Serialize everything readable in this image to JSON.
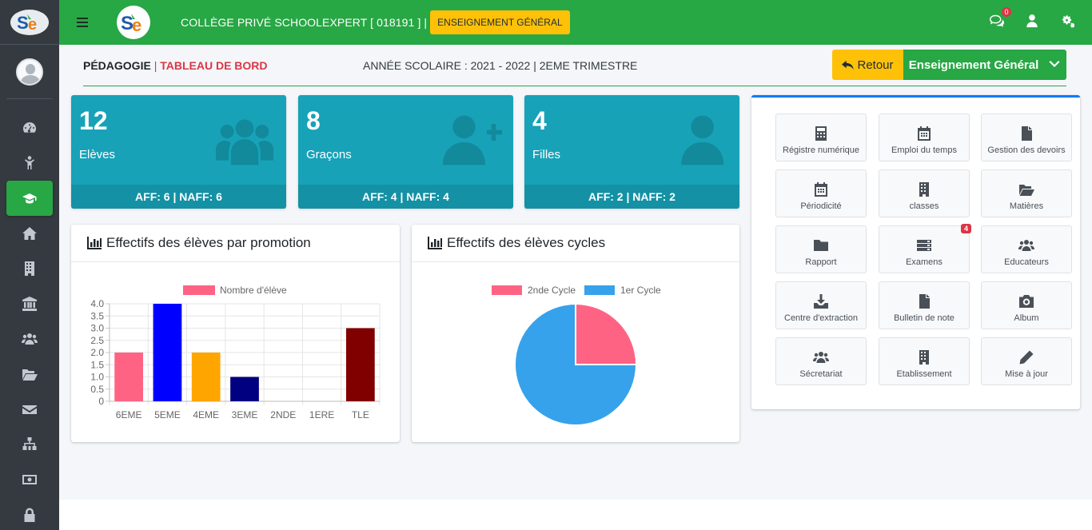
{
  "navbar": {
    "school_name": "COLLÈGE PRIVÉ SCHOOLEXPERT [ 018191 ] |",
    "badge": "ENSEIGNEMENT GÉNÉRAL",
    "messages_count": "0"
  },
  "header": {
    "section": "PÉDAGOGIE",
    "separator": "|",
    "page": "TABLEAU DE BORD",
    "year": "ANNÉE SCOLAIRE : 2021 - 2022 | 2EME TRIMESTRE",
    "back_label": "Retour",
    "dropdown_label": "Enseignement Général"
  },
  "stats": [
    {
      "value": "12",
      "label": "Elèves",
      "footer": "AFF: 6 | NAFF: 6",
      "icon": "users-icon"
    },
    {
      "value": "8",
      "label": "Graçons",
      "footer": "AFF: 4 | NAFF: 4",
      "icon": "user-plus-icon"
    },
    {
      "value": "4",
      "label": "Filles",
      "footer": "AFF: 2 | NAFF: 2",
      "icon": "user-icon"
    }
  ],
  "charts": {
    "promo_title": "Effectifs des élèves par promotion",
    "cycles_title": "Effectifs des élèves cycles"
  },
  "chart_data": [
    {
      "type": "bar",
      "title": "Effectifs des élèves par promotion",
      "categories": [
        "6EME",
        "5EME",
        "4EME",
        "3EME",
        "2NDE",
        "1ERE",
        "TLE"
      ],
      "series": [
        {
          "name": "Nombre d'élève",
          "values": [
            2,
            4,
            2,
            1,
            0,
            0,
            3
          ]
        }
      ],
      "colors": [
        "#ff6384",
        "#0000ff",
        "#ffa500",
        "#000080",
        "#36a2eb",
        "#4bc0c0",
        "#800000"
      ],
      "ylim": [
        0,
        4
      ],
      "yticks": [
        "4.0",
        "3.5",
        "3.0",
        "2.5",
        "2.0",
        "1.5",
        "1.0",
        "0.5",
        "0"
      ],
      "legend_position": "top",
      "grid": true
    },
    {
      "type": "pie",
      "title": "Effectifs des élèves cycles",
      "labels": [
        "2nde Cycle",
        "1er Cycle"
      ],
      "values": [
        3,
        9
      ],
      "colors": [
        "#ff6384",
        "#36a2eb"
      ],
      "legend_position": "top"
    }
  ],
  "tools": [
    {
      "label": "Régistre numérique",
      "icon": "calculator-icon"
    },
    {
      "label": "Emploi du temps",
      "icon": "calendar-icon"
    },
    {
      "label": "Gestion des devoirs",
      "icon": "file-icon"
    },
    {
      "label": "Périodicité",
      "icon": "calendar-icon"
    },
    {
      "label": "classes",
      "icon": "building-icon"
    },
    {
      "label": "Matières",
      "icon": "folder-open-icon"
    },
    {
      "label": "Rapport",
      "icon": "folder-icon"
    },
    {
      "label": "Examens",
      "icon": "server-icon",
      "badge": "4"
    },
    {
      "label": "Educateurs",
      "icon": "users-icon"
    },
    {
      "label": "Centre d'extraction",
      "icon": "download-icon"
    },
    {
      "label": "Bulletin de note",
      "icon": "file-icon"
    },
    {
      "label": "Album",
      "icon": "camera-icon"
    },
    {
      "label": "Sécretariat",
      "icon": "users-icon"
    },
    {
      "label": "Etablissement",
      "icon": "building-icon"
    },
    {
      "label": "Mise à jour",
      "icon": "pencil-icon"
    }
  ]
}
